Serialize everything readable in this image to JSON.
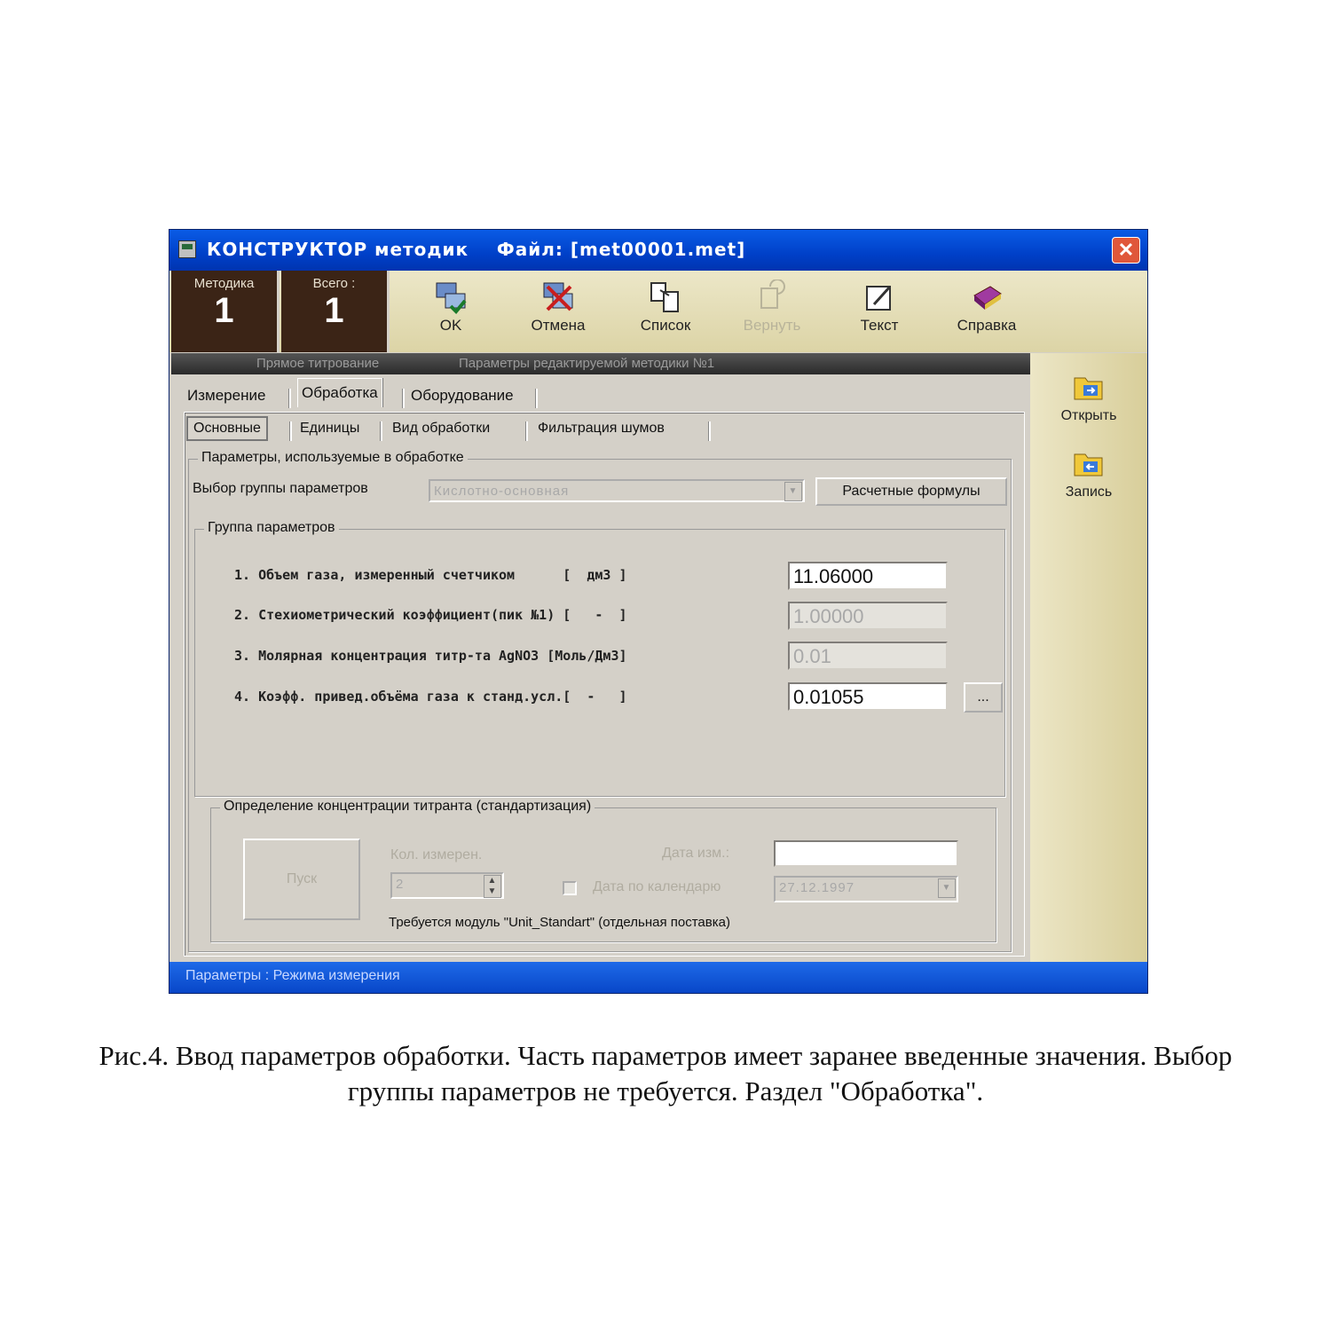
{
  "window": {
    "title": "КОНСТРУКТОР методик    Файл: [met00001.met]",
    "close_glyph": "✕"
  },
  "toolbar": {
    "counters": [
      {
        "label": "Методика",
        "value": "1"
      },
      {
        "label": "Всего :",
        "value": "1"
      }
    ],
    "buttons": {
      "ok": "OK",
      "cancel": "Отмена",
      "list": "Список",
      "restore": "Вернуть",
      "text": "Текст",
      "help": "Справка"
    }
  },
  "infobar": {
    "left": "Прямое титрование",
    "right": "Параметры редактируемой методики №1"
  },
  "side": {
    "open": "Открыть",
    "save": "Запись"
  },
  "tabs": {
    "main": [
      "Измерение",
      "Обработка",
      "Оборудование"
    ],
    "active_main": "Обработка",
    "sub": [
      "Основные",
      "Единицы",
      "Вид обработки",
      "Фильтрация шумов"
    ],
    "active_sub": "Основные"
  },
  "processing": {
    "group_title": "Параметры, используемые в обработке",
    "select_label": "Выбор группы параметров",
    "select_value": "Кислотно-основная",
    "formulas_button": "Расчетные формулы",
    "param_group_title": "Группа параметров",
    "params": [
      {
        "label": "1. Объем газа, измеренный счетчиком      [  дм3 ]",
        "value": "11.06000",
        "enabled": true
      },
      {
        "label": "2. Стехиометрический коэффициент(пик №1) [   -  ]",
        "value": "1.00000",
        "enabled": false
      },
      {
        "label": "3. Молярная концентрация титр-та AgNO3 [Моль/Дм3]",
        "value": "0.01",
        "enabled": false
      },
      {
        "label": "4. Коэфф. привед.объёма газа к станд.усл.[  -   ]",
        "value": "0.01055",
        "enabled": true
      }
    ],
    "ellipsis_button": "..."
  },
  "standardization": {
    "group_title": "Определение концентрации титранта (стандартизация)",
    "start_button": "Пуск",
    "count_label": "Кол. измерен.",
    "count_value": "2",
    "date_label": "Дата изм.:",
    "date_value": "",
    "calendar_checkbox_label": "Дата по календарю",
    "calendar_value": "27.12.1997",
    "note": "Требуется модуль \"Unit_Standart\" (отдельная поставка)"
  },
  "statusbar": {
    "text": "Параметры : Режима измерения"
  },
  "caption": {
    "line1": "Рис.4. Ввод параметров обработки. Часть параметров имеет заранее введенные значения. Выбор",
    "line2": "группы параметров не требуется. Раздел \"Обработка\"."
  }
}
